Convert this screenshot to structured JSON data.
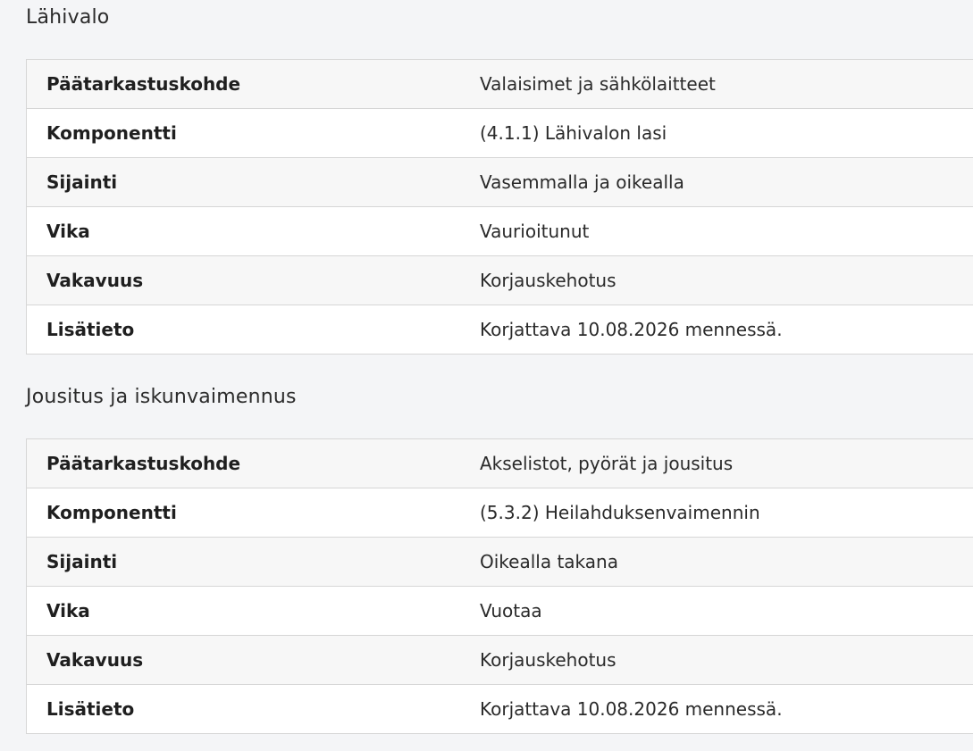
{
  "sections": [
    {
      "title": "Lähivalo",
      "rows": [
        {
          "label": "Päätarkastuskohde",
          "value": "Valaisimet ja sähkölaitteet"
        },
        {
          "label": "Komponentti",
          "value": "(4.1.1) Lähivalon lasi"
        },
        {
          "label": "Sijainti",
          "value": "Vasemmalla ja oikealla"
        },
        {
          "label": "Vika",
          "value": "Vaurioitunut"
        },
        {
          "label": "Vakavuus",
          "value": "Korjauskehotus"
        },
        {
          "label": "Lisätieto",
          "value": "Korjattava 10.08.2026 mennessä."
        }
      ]
    },
    {
      "title": "Jousitus ja iskunvaimennus",
      "rows": [
        {
          "label": "Päätarkastuskohde",
          "value": "Akselistot, pyörät ja jousitus"
        },
        {
          "label": "Komponentti",
          "value": "(5.3.2) Heilahduksenvaimennin"
        },
        {
          "label": "Sijainti",
          "value": "Oikealla takana"
        },
        {
          "label": "Vika",
          "value": "Vuotaa"
        },
        {
          "label": "Vakavuus",
          "value": "Korjauskehotus"
        },
        {
          "label": "Lisätieto",
          "value": "Korjattava 10.08.2026 mennessä."
        }
      ]
    }
  ]
}
